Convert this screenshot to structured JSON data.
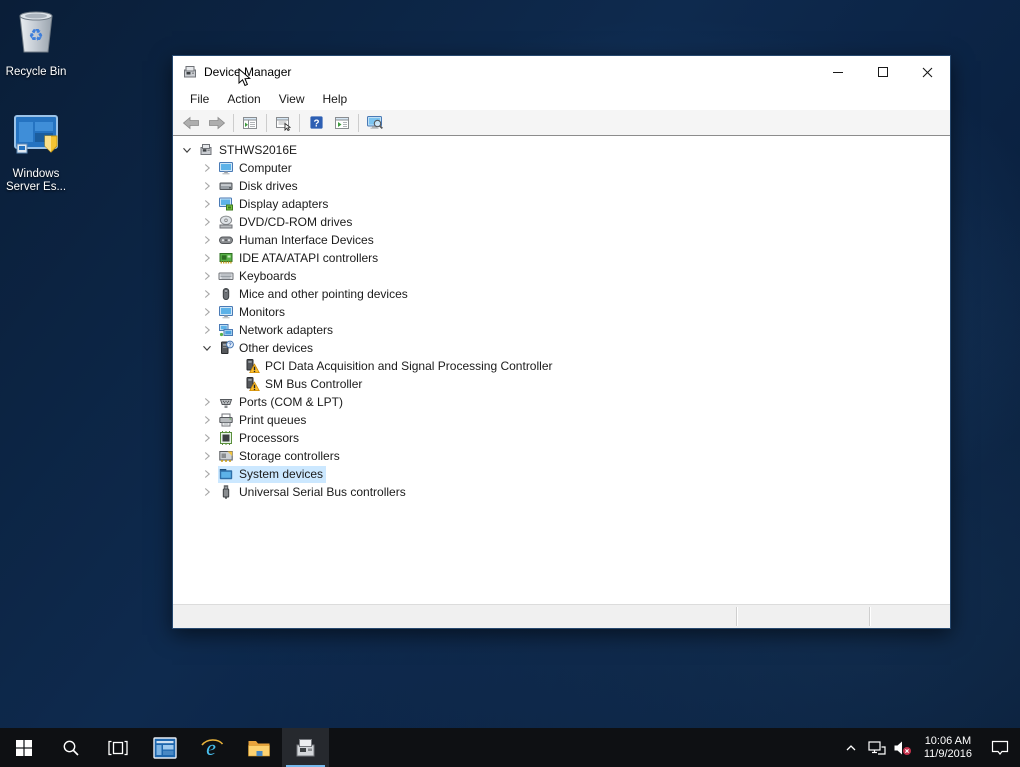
{
  "colors": {
    "selection_bg": "#cce8ff",
    "taskbar_bg": "#0e1013",
    "active_underline": "#76b9ed",
    "warning_yellow": "#fdbf2d",
    "help_blue": "#2d5fb3",
    "desktop_base": "#0c2444"
  },
  "desktop": {
    "icons": [
      {
        "id": "recycle-bin",
        "icon": "recycle-bin",
        "lines": [
          "Recycle Bin"
        ]
      },
      {
        "id": "windows-server-essentials",
        "icon": "windows-server-essentials",
        "lines": [
          "Windows",
          "Server Es..."
        ]
      }
    ]
  },
  "window": {
    "title": "Device Manager",
    "icon": "device-manager-small",
    "controls": [
      {
        "id": "minimize",
        "icon": "minimize"
      },
      {
        "id": "maximize",
        "icon": "maximize"
      },
      {
        "id": "close",
        "icon": "close"
      }
    ],
    "menu": [
      {
        "id": "file",
        "label": "File"
      },
      {
        "id": "action",
        "label": "Action"
      },
      {
        "id": "view",
        "label": "View"
      },
      {
        "id": "help",
        "label": "Help"
      }
    ],
    "toolbar": [
      {
        "type": "button",
        "id": "back",
        "icon": "back-arrow"
      },
      {
        "type": "button",
        "id": "forward",
        "icon": "forward-arrow"
      },
      {
        "type": "sep"
      },
      {
        "type": "button",
        "id": "show-console-tree",
        "icon": "console-tree"
      },
      {
        "type": "sep"
      },
      {
        "type": "button",
        "id": "properties",
        "icon": "properties"
      },
      {
        "type": "sep"
      },
      {
        "type": "button",
        "id": "help",
        "icon": "help"
      },
      {
        "type": "button",
        "id": "devices-by-type",
        "icon": "devices-list"
      },
      {
        "type": "sep"
      },
      {
        "type": "button",
        "id": "scan-hardware-changes",
        "icon": "scan-hardware"
      }
    ],
    "tree": [
      {
        "label": "STHWS2016E",
        "icon": "computer-root",
        "level": 0,
        "expander": "expanded",
        "selected": false
      },
      {
        "label": "Computer",
        "icon": "monitor",
        "level": 1,
        "expander": "collapsed",
        "selected": false
      },
      {
        "label": "Disk drives",
        "icon": "disk-drive",
        "level": 1,
        "expander": "collapsed",
        "selected": false
      },
      {
        "label": "Display adapters",
        "icon": "display-adapter",
        "level": 1,
        "expander": "collapsed",
        "selected": false
      },
      {
        "label": "DVD/CD-ROM drives",
        "icon": "dvd-drive",
        "level": 1,
        "expander": "collapsed",
        "selected": false
      },
      {
        "label": "Human Interface Devices",
        "icon": "hid-device",
        "level": 1,
        "expander": "collapsed",
        "selected": false
      },
      {
        "label": "IDE ATA/ATAPI controllers",
        "icon": "ide-controller",
        "level": 1,
        "expander": "collapsed",
        "selected": false
      },
      {
        "label": "Keyboards",
        "icon": "keyboard",
        "level": 1,
        "expander": "collapsed",
        "selected": false
      },
      {
        "label": "Mice and other pointing devices",
        "icon": "mouse",
        "level": 1,
        "expander": "collapsed",
        "selected": false
      },
      {
        "label": "Monitors",
        "icon": "monitor",
        "level": 1,
        "expander": "collapsed",
        "selected": false
      },
      {
        "label": "Network adapters",
        "icon": "network-adapter",
        "level": 1,
        "expander": "collapsed",
        "selected": false
      },
      {
        "label": "Other devices",
        "icon": "other-device",
        "level": 1,
        "expander": "expanded",
        "selected": false
      },
      {
        "label": "PCI Data Acquisition and Signal Processing Controller",
        "icon": "unknown-device-warning",
        "level": 2,
        "expander": "none",
        "selected": false
      },
      {
        "label": "SM Bus Controller",
        "icon": "unknown-device-warning",
        "level": 2,
        "expander": "none",
        "selected": false
      },
      {
        "label": "Ports (COM & LPT)",
        "icon": "serial-port",
        "level": 1,
        "expander": "collapsed",
        "selected": false
      },
      {
        "label": "Print queues",
        "icon": "printer",
        "level": 1,
        "expander": "collapsed",
        "selected": false
      },
      {
        "label": "Processors",
        "icon": "processor",
        "level": 1,
        "expander": "collapsed",
        "selected": false
      },
      {
        "label": "Storage controllers",
        "icon": "storage-controller",
        "level": 1,
        "expander": "collapsed",
        "selected": false
      },
      {
        "label": "System devices",
        "icon": "system-device",
        "level": 1,
        "expander": "collapsed",
        "selected": true
      },
      {
        "label": "Universal Serial Bus controllers",
        "icon": "usb-controller",
        "level": 1,
        "expander": "collapsed",
        "selected": false
      }
    ]
  },
  "taskbar": {
    "items": [
      {
        "id": "start",
        "icon": "start",
        "active": false
      },
      {
        "id": "search",
        "icon": "search",
        "active": false
      },
      {
        "id": "task-view",
        "icon": "task-view",
        "active": false
      },
      {
        "id": "server-manager",
        "icon": "server-manager",
        "active": false
      },
      {
        "id": "internet-explorer",
        "icon": "internet-explorer",
        "active": false
      },
      {
        "id": "file-explorer",
        "icon": "file-explorer",
        "active": false
      },
      {
        "id": "device-manager",
        "icon": "device-manager-app",
        "active": true
      }
    ],
    "tray": {
      "icons": [
        {
          "id": "hidden-icons",
          "icon": "chevron-up"
        },
        {
          "id": "network",
          "icon": "network-tray"
        },
        {
          "id": "volume-muted",
          "icon": "volume-muted"
        }
      ],
      "time": "10:06 AM",
      "date": "11/9/2016",
      "action_center_icon": "action-center"
    }
  }
}
